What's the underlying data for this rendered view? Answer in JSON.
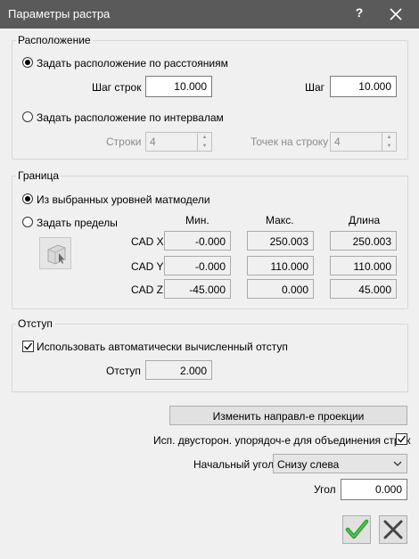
{
  "window": {
    "title": "Параметры растра",
    "help": "?"
  },
  "placement": {
    "group_label": "Расположение",
    "by_distance_label": "Задать расположение по расстояниям",
    "row_step_label": "Шаг строк",
    "row_step_value": "10.000",
    "step_label": "Шаг",
    "step_value": "10.000",
    "by_interval_label": "Задать расположение по интервалам",
    "rows_label": "Строки",
    "rows_value": "4",
    "points_label": "Точек на строку",
    "points_value": "4"
  },
  "bounds": {
    "group_label": "Граница",
    "from_levels_label": "Из выбранных уровней матмодели",
    "set_limits_label": "Задать пределы",
    "headers": {
      "min": "Мин.",
      "max": "Макс.",
      "length": "Длина"
    },
    "rows": [
      {
        "label": "CAD X",
        "min": "-0.000",
        "max": "250.003",
        "length": "250.003"
      },
      {
        "label": "CAD Y",
        "min": "-0.000",
        "max": "110.000",
        "length": "110.000"
      },
      {
        "label": "CAD Z",
        "min": "-45.000",
        "max": "0.000",
        "length": "45.000"
      }
    ]
  },
  "offset": {
    "group_label": "Отступ",
    "auto_label": "Использовать автоматически вычисленный отступ",
    "offset_label": "Отступ",
    "offset_value": "2.000"
  },
  "projection_button_label": "Изменить направл-е проекции",
  "bidirectional_label": "Исп. двусторон. упорядоч-е для объединения строк",
  "start_corner": {
    "label": "Начальный угол",
    "value": "Снизу слева"
  },
  "angle": {
    "label": "Угол",
    "value": "0.000"
  },
  "icons": {
    "ok": "checkmark-icon",
    "cancel": "x-icon",
    "close": "close-icon"
  }
}
